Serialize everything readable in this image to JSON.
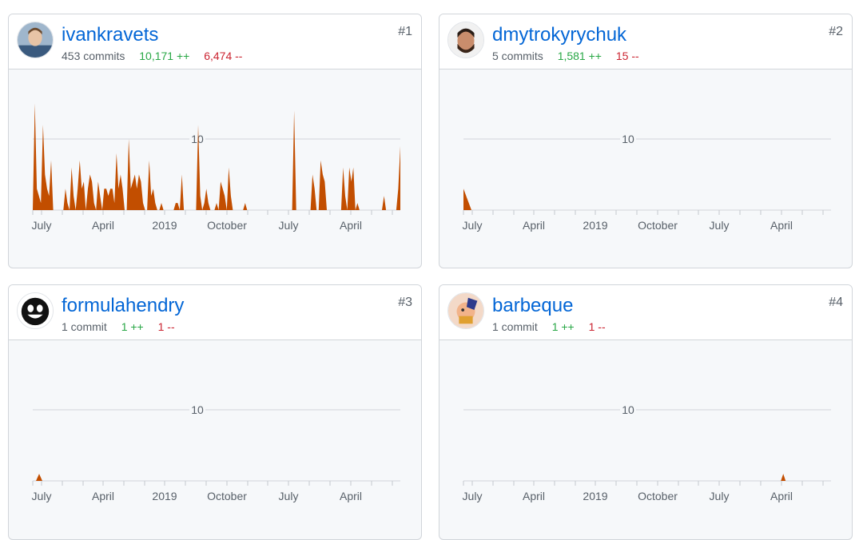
{
  "contributors": [
    {
      "username": "ivankravets",
      "commits": "453 commits",
      "additions": "10,171 ++",
      "deletions": "6,474 --",
      "rank": "#1",
      "avatar": "photo-avatar-blue",
      "chart_data": {
        "type": "area",
        "y_gridline": 10,
        "y_tick_label": "10",
        "ylim": [
          0,
          15
        ],
        "x_tick_labels": [
          "July",
          "April",
          "2019",
          "October",
          "July",
          "April"
        ],
        "values": [
          0,
          15,
          3,
          2,
          1,
          12,
          5,
          3,
          2,
          7,
          0,
          0,
          0,
          0,
          0,
          0,
          3,
          1,
          0,
          6,
          2,
          0,
          3,
          7,
          3,
          4,
          0,
          3,
          5,
          4,
          1,
          0,
          4,
          2,
          0,
          3,
          3,
          2,
          3,
          3,
          1,
          8,
          3,
          5,
          3,
          0,
          0,
          10,
          3,
          4,
          5,
          3,
          5,
          4,
          1,
          0,
          0,
          7,
          2,
          3,
          1,
          0,
          0,
          1,
          0,
          0,
          0,
          0,
          0,
          0,
          1,
          1,
          0,
          5,
          0,
          0,
          0,
          0,
          0,
          0,
          0,
          12,
          2,
          0,
          1,
          3,
          1,
          0,
          0,
          0,
          1,
          0,
          4,
          3,
          2,
          0,
          6,
          2,
          0,
          0,
          0,
          0,
          0,
          0,
          1,
          0,
          0,
          0,
          0,
          0,
          0,
          0,
          0,
          0,
          0,
          0,
          0,
          0,
          0,
          0,
          0,
          0,
          0,
          0,
          0,
          0,
          0,
          0,
          14,
          0,
          0,
          0,
          0,
          0,
          0,
          0,
          0,
          5,
          3,
          0,
          0,
          7,
          5,
          4,
          0,
          0,
          0,
          0,
          0,
          0,
          0,
          0,
          6,
          2,
          0,
          6,
          4,
          6,
          0,
          1,
          0,
          0,
          0,
          0,
          0,
          0,
          0,
          0,
          0,
          0,
          0,
          0,
          2,
          0,
          0,
          0,
          0,
          0,
          0,
          3,
          9
        ]
      }
    },
    {
      "username": "dmytrokyrychuk",
      "commits": "5 commits",
      "additions": "1,581 ++",
      "deletions": "15 --",
      "rank": "#2",
      "avatar": "photo-avatar-bearded",
      "chart_data": {
        "type": "area",
        "y_gridline": 10,
        "y_tick_label": "10",
        "ylim": [
          0,
          15
        ],
        "x_tick_labels": [
          "July",
          "April",
          "2019",
          "October",
          "July",
          "April"
        ],
        "values": [
          3,
          0
        ]
      }
    },
    {
      "username": "formulahendry",
      "commits": "1 commit",
      "additions": "1 ++",
      "deletions": "1 --",
      "rank": "#3",
      "avatar": "cartoon-black-face",
      "chart_data": {
        "type": "area",
        "y_gridline": 10,
        "y_tick_label": "10",
        "ylim": [
          0,
          15
        ],
        "x_tick_labels": [
          "July",
          "April",
          "2019",
          "October",
          "July",
          "April"
        ],
        "values": [
          0,
          0,
          1,
          0
        ]
      }
    },
    {
      "username": "barbeque",
      "commits": "1 commit",
      "additions": "1 ++",
      "deletions": "1 --",
      "rank": "#4",
      "avatar": "cartoon-character",
      "chart_data": {
        "type": "area",
        "y_gridline": 10,
        "y_tick_label": "10",
        "ylim": [
          0,
          15
        ],
        "x_tick_labels": [
          "July",
          "April",
          "2019",
          "October",
          "July",
          "April"
        ],
        "spike_position": 0.87,
        "values": [
          0,
          1,
          0
        ]
      }
    }
  ],
  "colors": {
    "area_fill": "#c24e00",
    "gridline": "#d1d5da",
    "link": "#0366d6",
    "additions": "#28a745",
    "deletions": "#cb2431"
  }
}
